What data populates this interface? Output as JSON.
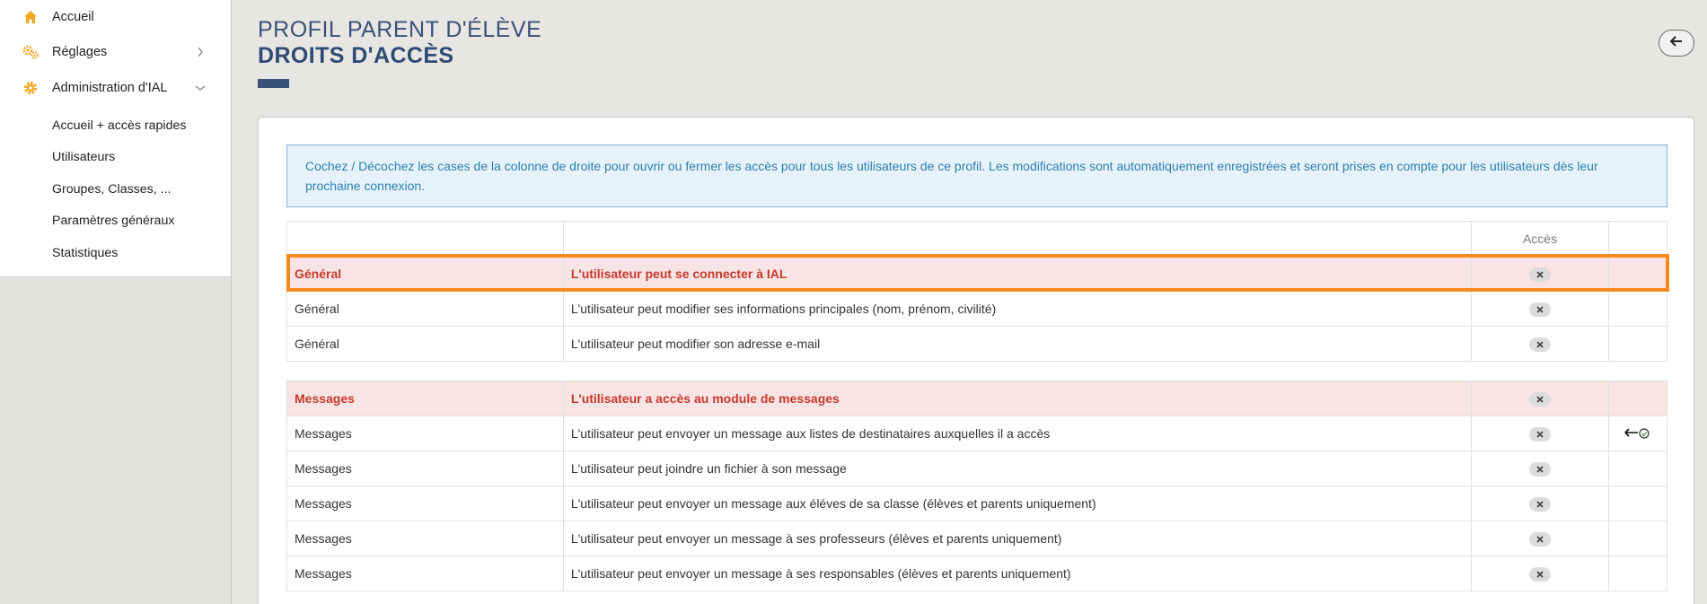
{
  "sidebar": {
    "items": [
      {
        "label": "Accueil",
        "icon": "home-icon"
      },
      {
        "label": "Réglages",
        "icon": "gears-icon"
      },
      {
        "label": "Administration d'IAL",
        "icon": "gear-icon"
      }
    ],
    "sub_items": [
      {
        "label": "Accueil + accès rapides"
      },
      {
        "label": "Utilisateurs"
      },
      {
        "label": "Groupes, Classes, ..."
      },
      {
        "label": "Paramètres généraux"
      },
      {
        "label": "Statistiques"
      }
    ]
  },
  "header": {
    "title_line1": "PROFIL PARENT D'ÉLÈVE",
    "title_line2": "DROITS D'ACCÈS"
  },
  "info_message": "Cochez / Décochez les cases de la colonne de droite pour ouvrir ou fermer les accès pour tous les utilisateurs de ce profil. Les modifications sont automatiquement enregistrées et seront prises en compte pour les utilisateurs dès leur prochaine connexion.",
  "table": {
    "access_header": "Accès",
    "groups": [
      {
        "rows": [
          {
            "category": "Général",
            "description": "L'utilisateur peut se connecter à IAL",
            "header": true
          },
          {
            "category": "Général",
            "description": "L'utilisateur peut modifier ses informations principales (nom, prénom, civilité)"
          },
          {
            "category": "Général",
            "description": "L'utilisateur peut modifier son adresse e-mail"
          }
        ]
      },
      {
        "rows": [
          {
            "category": "Messages",
            "description": "L'utilisateur a accès au module de messages",
            "header": true
          },
          {
            "category": "Messages",
            "description": "L'utilisateur peut envoyer un message aux listes de destinataires auxquelles il a accès"
          },
          {
            "category": "Messages",
            "description": "L'utilisateur peut joindre un fichier à son message"
          },
          {
            "category": "Messages",
            "description": "L'utilisateur peut envoyer un message aux éléves de sa classe (élèves et parents uniquement)"
          },
          {
            "category": "Messages",
            "description": "L'utilisateur peut envoyer un message à ses professeurs (élèves et parents uniquement)"
          },
          {
            "category": "Messages",
            "description": "L'utilisateur peut envoyer un message à ses responsables (élèves et parents uniquement)"
          }
        ]
      }
    ]
  },
  "colors": {
    "accent": "#3a5279",
    "danger_text": "#c53a2c",
    "danger_bg": "#f8e4e4",
    "highlight": "#f58a1f",
    "info_text": "#2d7fb0"
  }
}
